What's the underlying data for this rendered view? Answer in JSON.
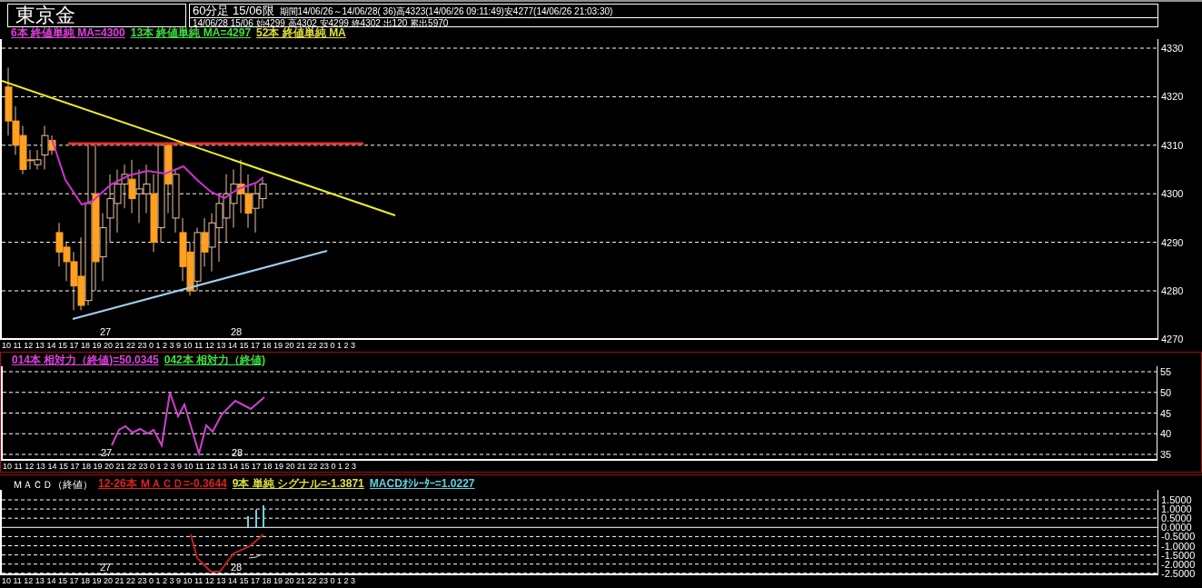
{
  "header": {
    "symbol": "東京金",
    "contract": "60分足 15/06限",
    "period": "期間14/06/26～14/06/28( 36)高4323(14/06/26 09:11:49)安4277(14/06/26 21:03:30)",
    "last_bar": "14/06/28 15/06 始4299 高4302 安4299 終4302 出120 累出5970"
  },
  "panels": [
    {
      "kind": "price",
      "legend": [
        {
          "text": "6本 終値単純 MA=4300",
          "color": "#e040e0"
        },
        {
          "text": "13本 終値単純 MA=4297",
          "color": "#40e040"
        },
        {
          "text": "52本 終値単純 MA",
          "color": "#e0e040"
        }
      ],
      "y_labels": [
        "4330",
        "4320",
        "4310",
        "4300",
        "4290",
        "4280",
        "4270"
      ],
      "day_labels": [
        "27",
        "28"
      ],
      "hour_labels": "10 11 12 13 14 15 17 18 19 20 21 22 23 0 1 2 3 9 10 11 12 13 14 15 17 18 19 20 21 22 23 0 1 2 3"
    },
    {
      "kind": "rsi",
      "legend": [
        {
          "text": "014本 相対力（終値)=50.0345",
          "color": "#e040e0"
        },
        {
          "text": "042本 相対力（終値)",
          "color": "#40e040"
        }
      ],
      "y_labels": [
        "55",
        "50",
        "45",
        "40",
        "35"
      ],
      "day_labels": [
        "27",
        "28"
      ],
      "hour_labels": "10 11 12 13 14 15 17 18 19 20 21 22 23 0 1 2 3 9 10 11 12 13 14 15 17 18 19 20 21 22 23 0 1 2 3"
    },
    {
      "kind": "macd",
      "title": "ＭＡＣＤ（終値）",
      "legend": [
        {
          "text": "12-26本 ＭＡＣＤ=-0.3644",
          "color": "#e02020"
        },
        {
          "text": "9本 単純 シグナル=-1.3871",
          "color": "#e0e040"
        },
        {
          "text": "MACDｵｼﾚｰﾀｰ=1.0227",
          "color": "#60d0e0"
        }
      ],
      "y_labels": [
        "1.5000",
        "1.0000",
        "0.5000",
        "0.0000",
        "-0.5000",
        "-1.0000",
        "-1.5000",
        "-2.0000",
        "-2.5000"
      ],
      "day_labels": [
        "27",
        "28"
      ],
      "hour_labels": "10 11 12 13 14 15 17 18 19 20 21 22 23 0 1 2 3 9 10 11 12 13 14 15 17 18 19 20 21 22 23 0 1 2 3"
    }
  ]
}
